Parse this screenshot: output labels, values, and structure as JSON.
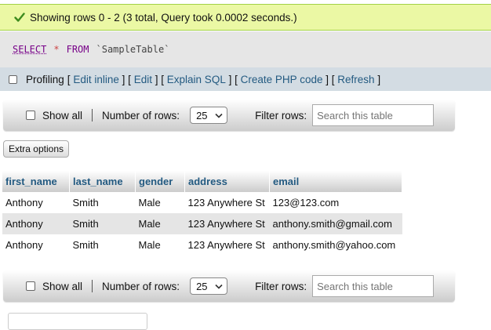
{
  "status": {
    "message": "Showing rows 0 - 2 (3 total, Query took 0.0002 seconds.)"
  },
  "query": {
    "select": "SELECT",
    "star": "*",
    "from": "FROM",
    "table": "`SampleTable`"
  },
  "profiling": {
    "label": "Profiling",
    "links": [
      "Edit inline",
      "Edit",
      "Explain SQL",
      "Create PHP code",
      "Refresh"
    ]
  },
  "nav": {
    "show_all": "Show all",
    "number_of_rows_label": "Number of rows:",
    "rows_value": "25",
    "filter_label": "Filter rows:",
    "filter_placeholder": "Search this table"
  },
  "extra_options": "Extra options",
  "table": {
    "columns": [
      "first_name",
      "last_name",
      "gender",
      "address",
      "email"
    ],
    "rows": [
      [
        "Anthony",
        "Smith",
        "Male",
        "123 Anywhere St",
        "123@123.com"
      ],
      [
        "Anthony",
        "Smith",
        "Male",
        "123 Anywhere St",
        "anthony.smith@gmail.com"
      ],
      [
        "Anthony",
        "Smith",
        "Male",
        "123 Anywhere St",
        "anthony.smith@yahoo.com"
      ]
    ]
  },
  "colors": {
    "success_bg": "#ebf8a4",
    "link": "#235a81",
    "profiling_bg": "#d3dce3"
  }
}
